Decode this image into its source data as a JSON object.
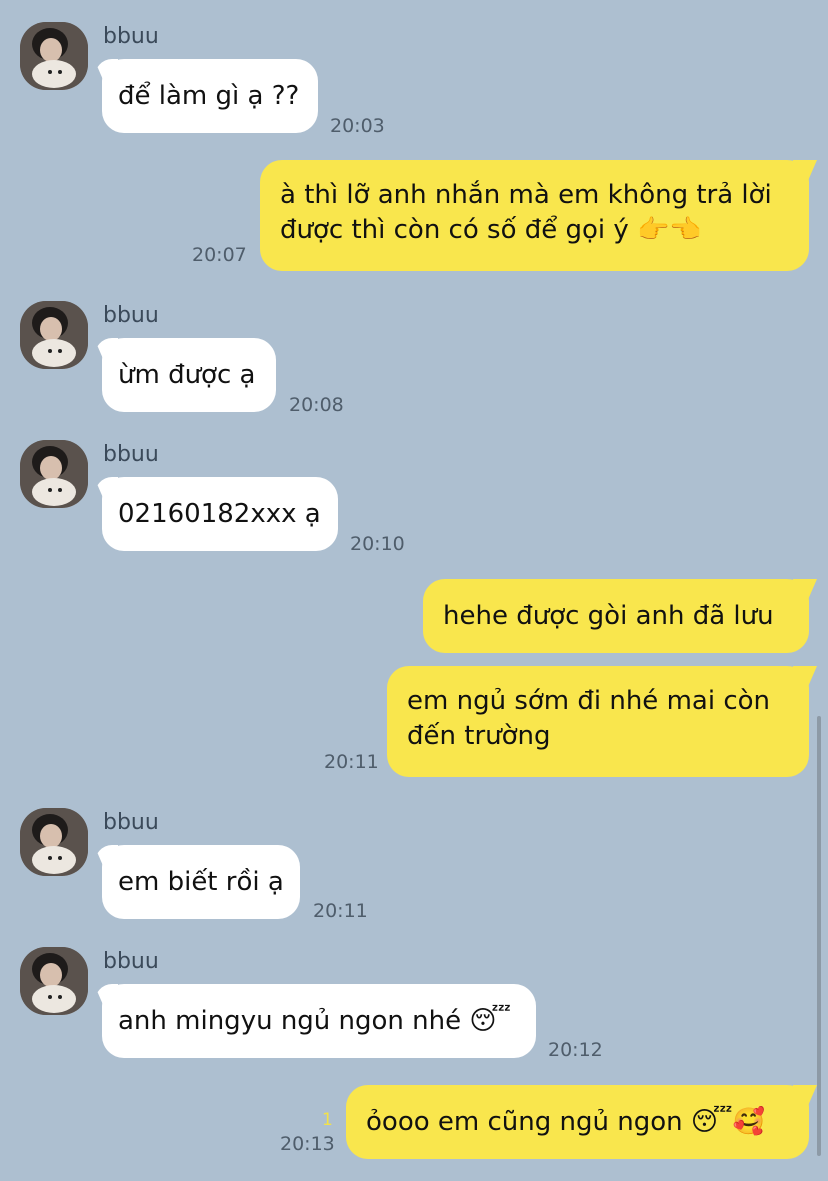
{
  "messages": [
    {
      "sender": "bbuu",
      "text": "để làm gì ạ ??",
      "time": "20:03"
    },
    {
      "text": "à thì lỡ anh nhắn mà em không trả lời được thì còn có số để gọi ý 👉👈",
      "time": "20:07"
    },
    {
      "sender": "bbuu",
      "text": "ừm được ạ",
      "time": "20:08"
    },
    {
      "sender": "bbuu",
      "text": "02160182xxx ạ",
      "time": "20:10"
    },
    {
      "text": "hehe được gòi anh đã lưu"
    },
    {
      "text": "em ngủ sớm đi nhé mai còn đến trường",
      "time": "20:11"
    },
    {
      "sender": "bbuu",
      "text": "em biết rồi ạ",
      "time": "20:11"
    },
    {
      "sender": "bbuu",
      "text": "anh mingyu ngủ ngon nhé 😴",
      "time": "20:12"
    },
    {
      "text": "ỏooo em cũng ngủ ngon 😴🥰",
      "time": "20:13",
      "unread": "1"
    }
  ],
  "colors": {
    "background": "#adbfd0",
    "incoming_bubble": "#ffffff",
    "outgoing_bubble": "#f9e64d",
    "unread_count": "#f2e149"
  }
}
